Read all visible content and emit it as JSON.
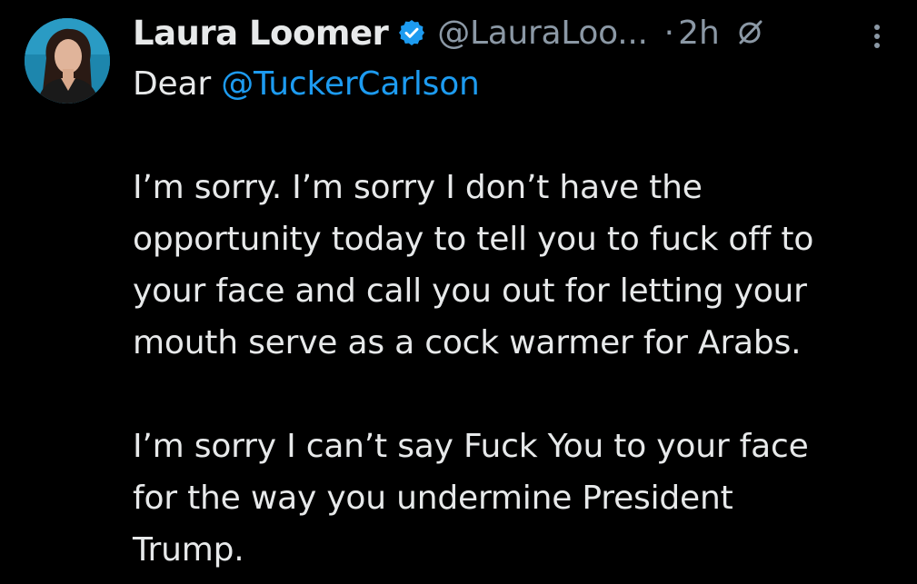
{
  "tweet": {
    "display_name": "Laura Loomer",
    "handle": "@LauraLoo...",
    "separator": "·",
    "time": "2h",
    "icons": {
      "verified": "verified-badge-icon",
      "edited": "edited-slash-icon",
      "more": "more-vertical-icon"
    },
    "colors": {
      "background": "#000000",
      "text": "#e7e9ea",
      "secondary": "#8b98a5",
      "link": "#1d9bf0",
      "verified": "#1d9bf0"
    },
    "body": {
      "greeting_prefix": "Dear ",
      "mention": "@TuckerCarlson",
      "paragraph1": [
        "I’m sorry. I’m sorry I don’t have the",
        "opportunity today to tell you to fuck off to",
        "your face and call you out for letting your",
        "mouth serve as a cock warmer for Arabs."
      ],
      "paragraph2": [
        "I’m sorry I can’t say Fuck You to your face",
        "for the way you undermine President",
        "Trump."
      ]
    }
  }
}
